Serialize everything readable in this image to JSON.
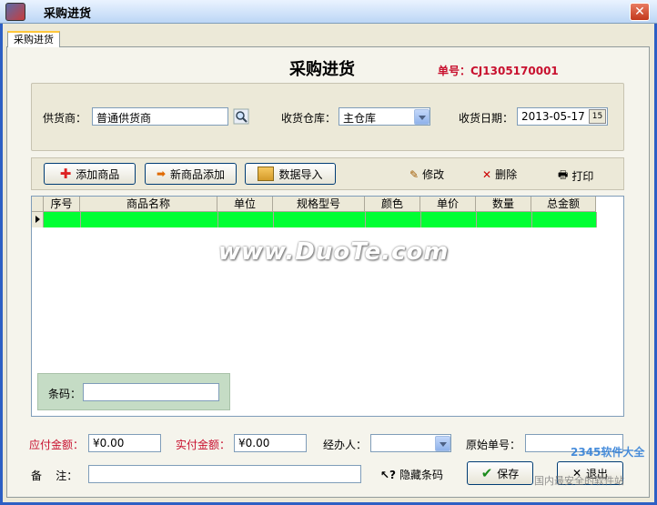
{
  "window": {
    "title": "采购进货"
  },
  "tab": {
    "label": "采购进货"
  },
  "header": {
    "title": "采购进货",
    "doc_no": "单号：CJ1305170001"
  },
  "form": {
    "supplier_label": "供货商：",
    "supplier_value": "普通供货商",
    "warehouse_label": "收货仓库：",
    "warehouse_value": "主仓库",
    "date_label": "收货日期：",
    "date_value": "2013-05-17",
    "date_btn": "15"
  },
  "toolbar": {
    "add_product": "添加商品",
    "new_product": "新商品添加",
    "import": "数据导入",
    "edit": "修改",
    "delete": "删除",
    "print": "打印"
  },
  "grid": {
    "columns": [
      "序号",
      "商品名称",
      "单位",
      "规格型号",
      "颜色",
      "单价",
      "数量",
      "总金额"
    ]
  },
  "barcode": {
    "label": "条码：",
    "value": ""
  },
  "footer": {
    "payable_label": "应付金额：",
    "payable_value": "¥0.00",
    "paid_label": "实付金额：",
    "paid_value": "¥0.00",
    "handler_label": "经办人：",
    "handler_value": "",
    "orig_no_label": "原始单号：",
    "orig_no_value": "",
    "note_label": "备    注：",
    "note_value": "",
    "hide_barcode": "隐藏条码",
    "save": "保存",
    "exit": "退出"
  },
  "watermark": {
    "text": "www.DuoTe.com",
    "logo_text": "2345软件大全",
    "logo_sub": "国内最安全的软件站"
  },
  "colors": {
    "accent_red": "#c8102e",
    "row_highlight": "#00ff33",
    "xp_blue": "#2d5fc4"
  }
}
